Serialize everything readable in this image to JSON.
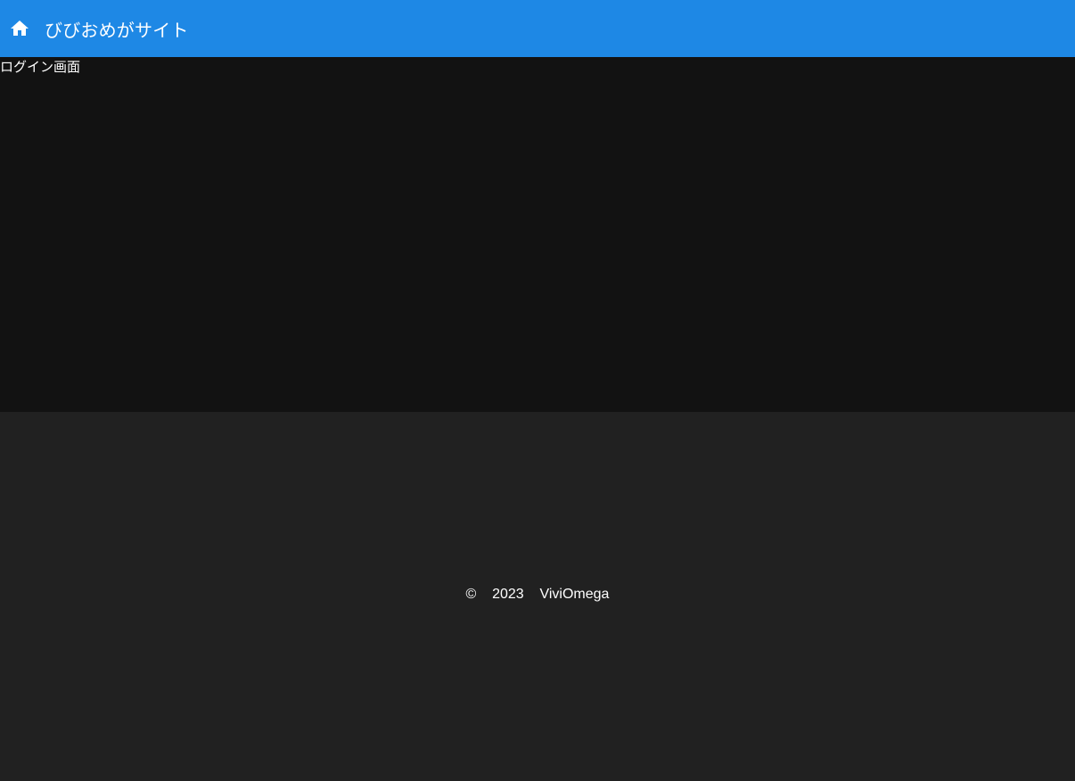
{
  "header": {
    "home_icon": "home-icon",
    "title": "びびおめがサイト",
    "background_color": "#1e88e5"
  },
  "main": {
    "heading": "ログイン画面",
    "background_color": "#121212"
  },
  "footer": {
    "copyright_symbol": "©",
    "year": "2023",
    "owner": "ViviOmega",
    "background_color": "#212121"
  }
}
